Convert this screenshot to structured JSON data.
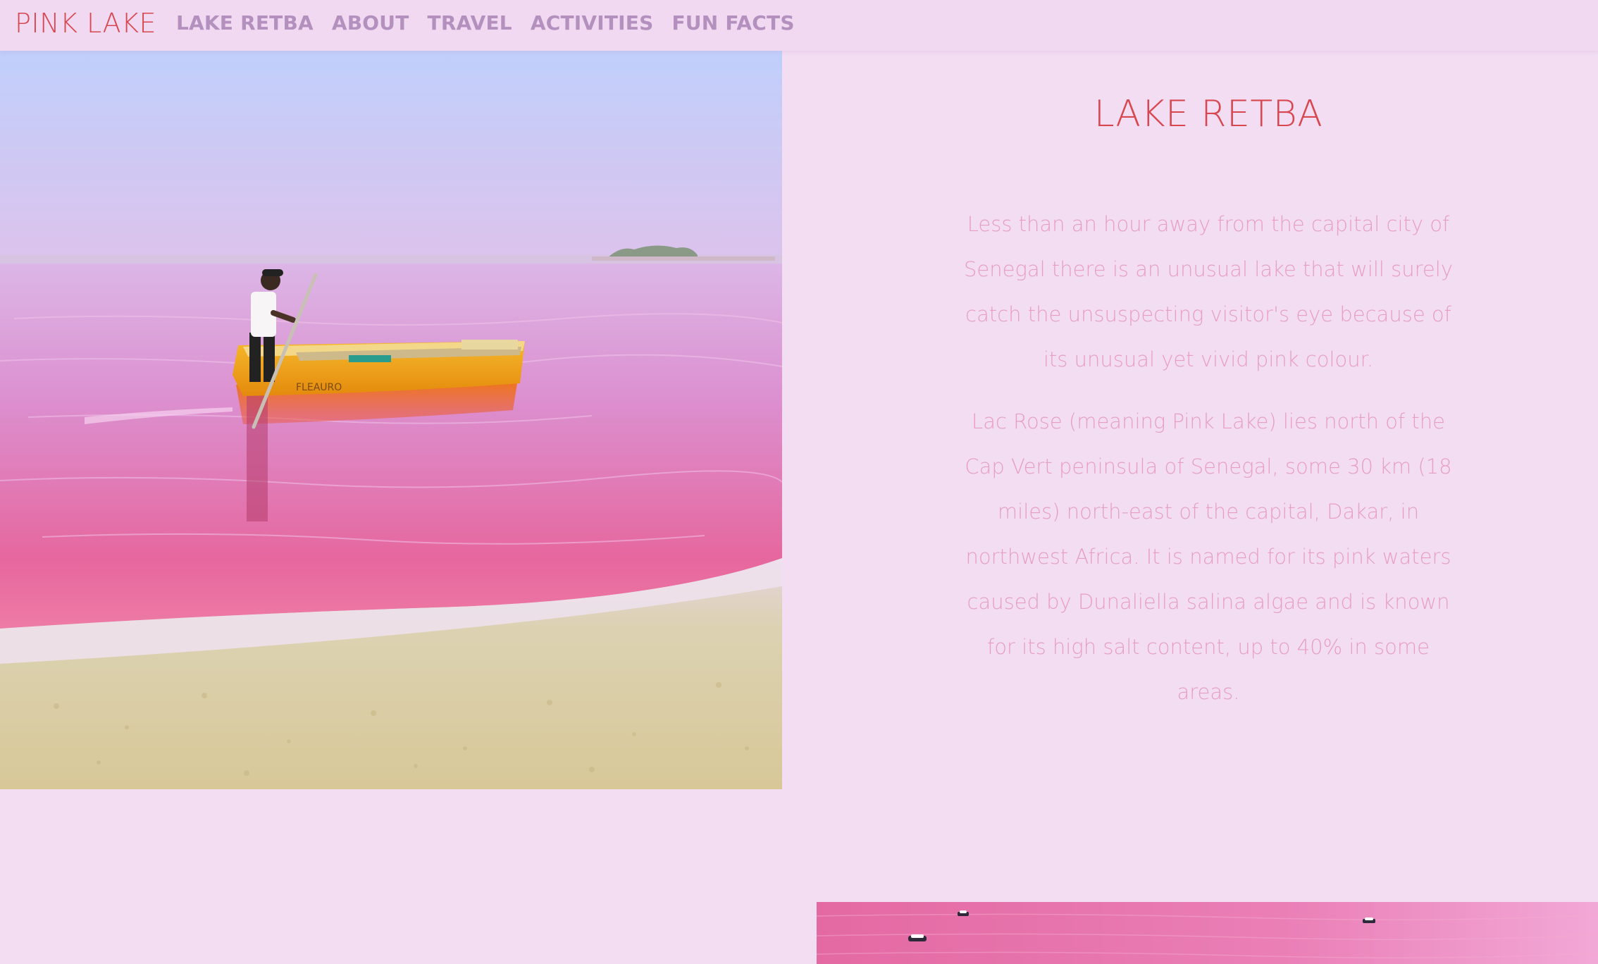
{
  "navbar": {
    "brand": "PINK LAKE",
    "links": [
      {
        "label": "LAKE RETBA"
      },
      {
        "label": "ABOUT"
      },
      {
        "label": "TRAVEL"
      },
      {
        "label": "ACTIVITIES"
      },
      {
        "label": "FUN FACTS"
      }
    ]
  },
  "hero_image": {
    "subject": "man-poling-boat-on-pink-lake",
    "boat_text": "FLEAURO"
  },
  "main": {
    "title": "LAKE RETBA",
    "paragraphs": [
      "Less than an hour away from the capital city of Senegal there is an unusual lake that will surely catch the unsuspecting visitor's eye because of its unusual yet vivid pink colour.",
      "Lac Rose (meaning Pink Lake) lies north of the Cap Vert peninsula of Senegal, some 30 km (18 miles) north-east of the capital, Dakar, in northwest Africa. It is named for its pink waters caused by Dunaliella salina algae and is known for its high salt content, up to 40% in some areas."
    ]
  },
  "aerial_image": {
    "subject": "aerial-view-pink-lake-with-boats"
  },
  "colors": {
    "page_background": "#f2ddf3",
    "brand": "#d8474f",
    "nav_link": "#b390bd",
    "heading": "#d8474f",
    "body_text": "#e79ec1"
  }
}
